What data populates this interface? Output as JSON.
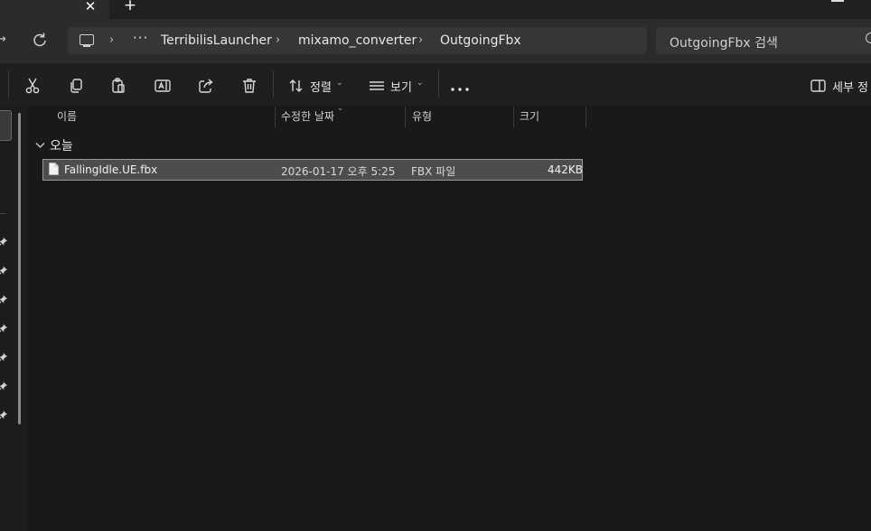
{
  "titlebar": {
    "close_glyph": "✕",
    "new_tab_glyph": "+"
  },
  "address": {
    "more_glyph": "···",
    "breadcrumbs": [
      "TerribilisLauncher",
      "mixamo_converter",
      "OutgoingFbx"
    ],
    "separator": "›"
  },
  "search": {
    "placeholder": "OutgoingFbx 검색"
  },
  "toolbar": {
    "icons": [
      "cut-icon",
      "copy-icon",
      "paste-icon",
      "rename-icon",
      "share-icon",
      "delete-icon"
    ],
    "sort_label": "정렬",
    "view_label": "보기",
    "details_label": "세부 정"
  },
  "columns": {
    "name": "이름",
    "date_modified": "수정한 날짜",
    "type": "유형",
    "size": "크기"
  },
  "groups": [
    {
      "label": "오늘",
      "files": [
        {
          "name": "FallingIdle.UE.fbx",
          "date_modified": "2026-01-17 오후 5:25",
          "type": "FBX 파일",
          "size": "442KB"
        }
      ]
    }
  ],
  "colors": {
    "background": "#191919",
    "toolbar": "#1f1f1f",
    "address_row": "#2b2b2b",
    "selection": "#4d4d4d"
  }
}
